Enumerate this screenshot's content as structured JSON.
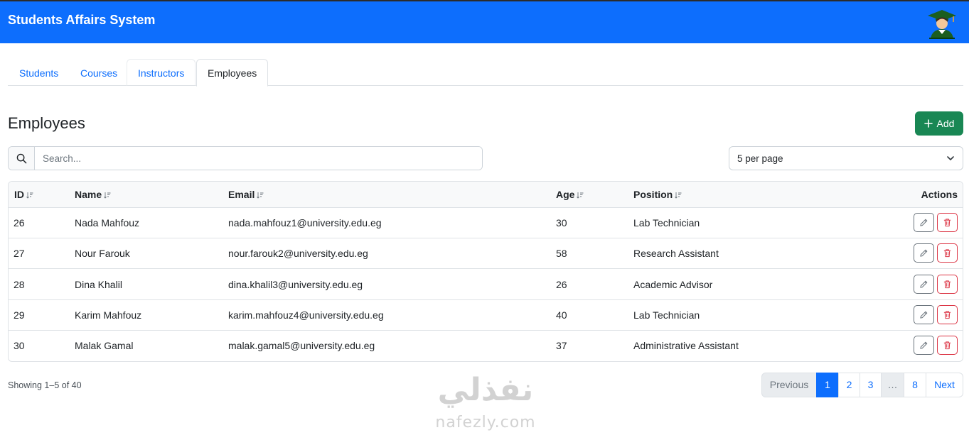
{
  "app": {
    "title": "Students Affairs System",
    "avatar_icon": "graduate-avatar-icon"
  },
  "tabs": [
    {
      "label": "Students",
      "active": false
    },
    {
      "label": "Courses",
      "active": false
    },
    {
      "label": "Instructors",
      "active": false
    },
    {
      "label": "Employees",
      "active": true
    }
  ],
  "page": {
    "title": "Employees",
    "add_label": "Add"
  },
  "search": {
    "placeholder": "Search...",
    "value": "",
    "icon": "search-icon"
  },
  "per_page": {
    "value": "5 per page",
    "icon": "chevron-down-icon"
  },
  "table": {
    "headers": {
      "id": "ID",
      "name": "Name",
      "email": "Email",
      "age": "Age",
      "position": "Position",
      "actions": "Actions"
    },
    "rows": [
      {
        "id": "26",
        "name": "Nada Mahfouz",
        "email": "nada.mahfouz1@university.edu.eg",
        "age": "30",
        "position": "Lab Technician"
      },
      {
        "id": "27",
        "name": "Nour Farouk",
        "email": "nour.farouk2@university.edu.eg",
        "age": "58",
        "position": "Research Assistant"
      },
      {
        "id": "28",
        "name": "Dina Khalil",
        "email": "dina.khalil3@university.edu.eg",
        "age": "26",
        "position": "Academic Advisor"
      },
      {
        "id": "29",
        "name": "Karim Mahfouz",
        "email": "karim.mahfouz4@university.edu.eg",
        "age": "40",
        "position": "Lab Technician"
      },
      {
        "id": "30",
        "name": "Malak Gamal",
        "email": "malak.gamal5@university.edu.eg",
        "age": "37",
        "position": "Administrative Assistant"
      }
    ]
  },
  "footer": {
    "showing": "Showing 1–5 of 40",
    "pagination": {
      "previous": "Previous",
      "pages": [
        "1",
        "2",
        "3",
        "…",
        "8"
      ],
      "next": "Next",
      "current": "1"
    }
  },
  "watermark": {
    "arabic": "نفذلي",
    "latin": "nafezly.com"
  },
  "colors": {
    "primary": "#0d6efd",
    "success": "#198754",
    "danger": "#dc3545",
    "secondary": "#6c757d"
  }
}
